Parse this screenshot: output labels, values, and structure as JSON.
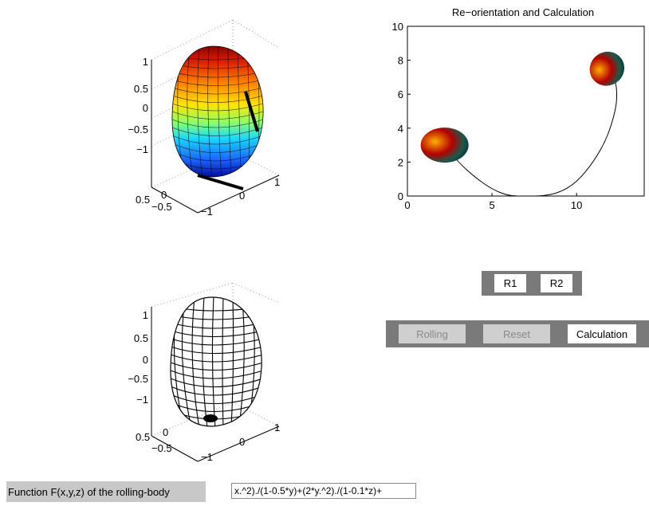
{
  "plot3d_top": {
    "z_ticks": [
      "1",
      "0.5",
      "0",
      "−0.5",
      "−1"
    ],
    "x_ticks": [
      "0.5",
      "0",
      "−0.5"
    ],
    "y_ticks": [
      "1",
      "0",
      "−1"
    ]
  },
  "plot3d_bottom": {
    "z_ticks": [
      "1",
      "0.5",
      "0",
      "−0.5",
      "−1"
    ],
    "x_ticks": [
      "0.5",
      "0",
      "−0.5"
    ],
    "y_ticks": [
      "1",
      "0",
      "−1"
    ]
  },
  "chart_data": {
    "type": "line",
    "title": "Re−orientation and Calculation",
    "xlabel": "",
    "ylabel": "",
    "xlim": [
      0,
      14
    ],
    "ylim": [
      0,
      10
    ],
    "x_ticks": [
      0,
      5,
      10
    ],
    "y_ticks": [
      0,
      2,
      4,
      6,
      8,
      10
    ],
    "grid": false,
    "series": [
      {
        "values_x": [
          2.2,
          3.0,
          4.0,
          5.0,
          6.0,
          7.0,
          8.0,
          9.0,
          10.0,
          11.0,
          11.8,
          12.3,
          12.4,
          12.3,
          12.0
        ],
        "values_y": [
          3.0,
          2.0,
          1.1,
          0.4,
          0.0,
          0.0,
          0.0,
          0.2,
          0.8,
          2.0,
          3.4,
          5.0,
          6.0,
          6.8,
          7.2
        ]
      }
    ],
    "bodies": [
      {
        "x": 2.2,
        "y": 3.0
      },
      {
        "x": 11.8,
        "y": 7.5
      }
    ]
  },
  "orientation_buttons": {
    "r1": "R1",
    "r2": "R2"
  },
  "action_buttons": {
    "rolling": "Rolling",
    "reset": "Reset",
    "calculation": "Calculation"
  },
  "function_panel": {
    "label": "Function F(x,y,z) of the rolling-body",
    "value": "x.^2)./(1-0.5*y)+(2*y.^2)./(1-0.1*z)+"
  }
}
